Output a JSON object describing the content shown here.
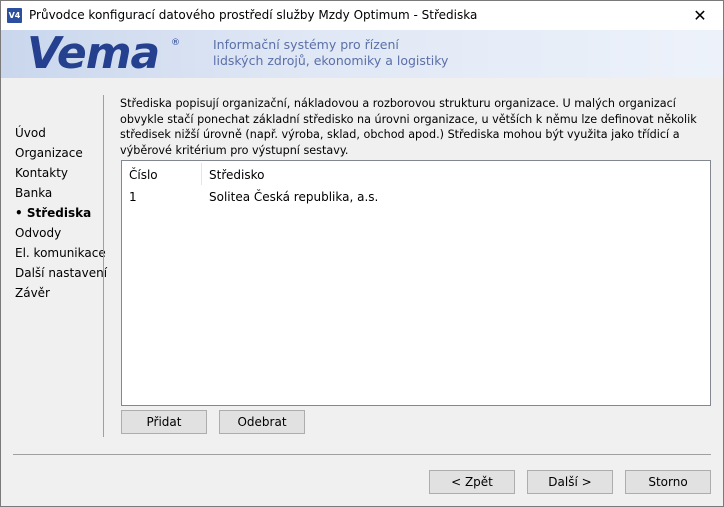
{
  "window": {
    "title": "Průvodce konfigurací datového prostředí služby Mzdy Optimum - Střediska",
    "app_icon_text": "V4",
    "close_glyph": "✕"
  },
  "banner": {
    "logo_text": "Vema",
    "logo_mark": "®",
    "line1": "Informační systémy pro řízení",
    "line2": "lidských zdrojů, ekonomiky a logistiky"
  },
  "nav": {
    "items": [
      {
        "label": "Úvod",
        "active": false
      },
      {
        "label": "Organizace",
        "active": false
      },
      {
        "label": "Kontakty",
        "active": false
      },
      {
        "label": "Banka",
        "active": false
      },
      {
        "label": "• Střediska",
        "active": true
      },
      {
        "label": "Odvody",
        "active": false
      },
      {
        "label": "El. komunikace",
        "active": false
      },
      {
        "label": "Další nastavení",
        "active": false
      },
      {
        "label": "Závěr",
        "active": false
      }
    ]
  },
  "main": {
    "description": "Střediska popisují organizační, nákladovou a rozborovou strukturu organizace. U malých organizací obvykle stačí ponechat základní středisko na úrovni organizace, u větších k němu lze definovat několik středisek nižší úrovně (např. výroba, sklad, obchod apod.) Střediska mohou být využita jako třídicí a výběrové kritérium pro výstupní sestavy.",
    "table": {
      "columns": [
        "Číslo",
        "Středisko"
      ],
      "rows": [
        {
          "cislo": "1",
          "stredisko": "Solitea Česká republika, a.s."
        }
      ]
    },
    "add_button": "Přidat",
    "remove_button": "Odebrat"
  },
  "footer": {
    "back_button": "< Zpět",
    "next_button": "Další >",
    "cancel_button": "Storno"
  }
}
